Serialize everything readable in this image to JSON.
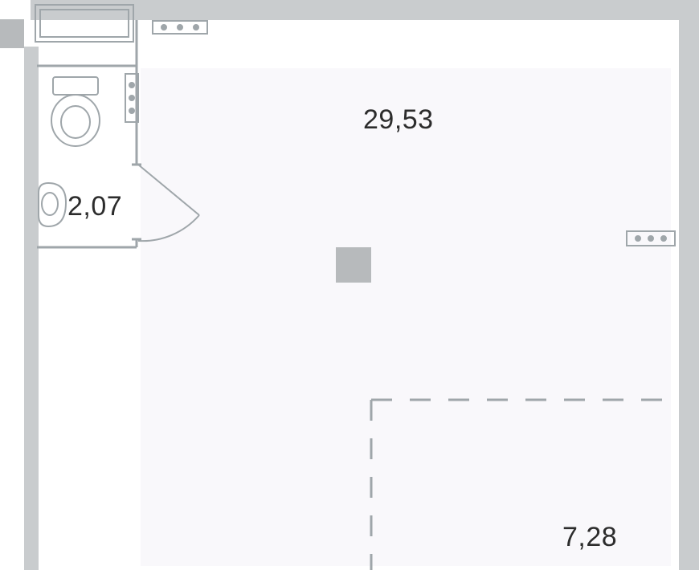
{
  "floorplan": {
    "rooms": {
      "main_room": {
        "area_label": "29,53"
      },
      "bathroom": {
        "area_label": "2,07"
      },
      "zone": {
        "area_label": "7,28"
      }
    },
    "colors": {
      "wall": "#c9ccce",
      "thin": "#9fa6aa",
      "pillar": "#b7babc",
      "tint": "#f9f8fb"
    }
  }
}
